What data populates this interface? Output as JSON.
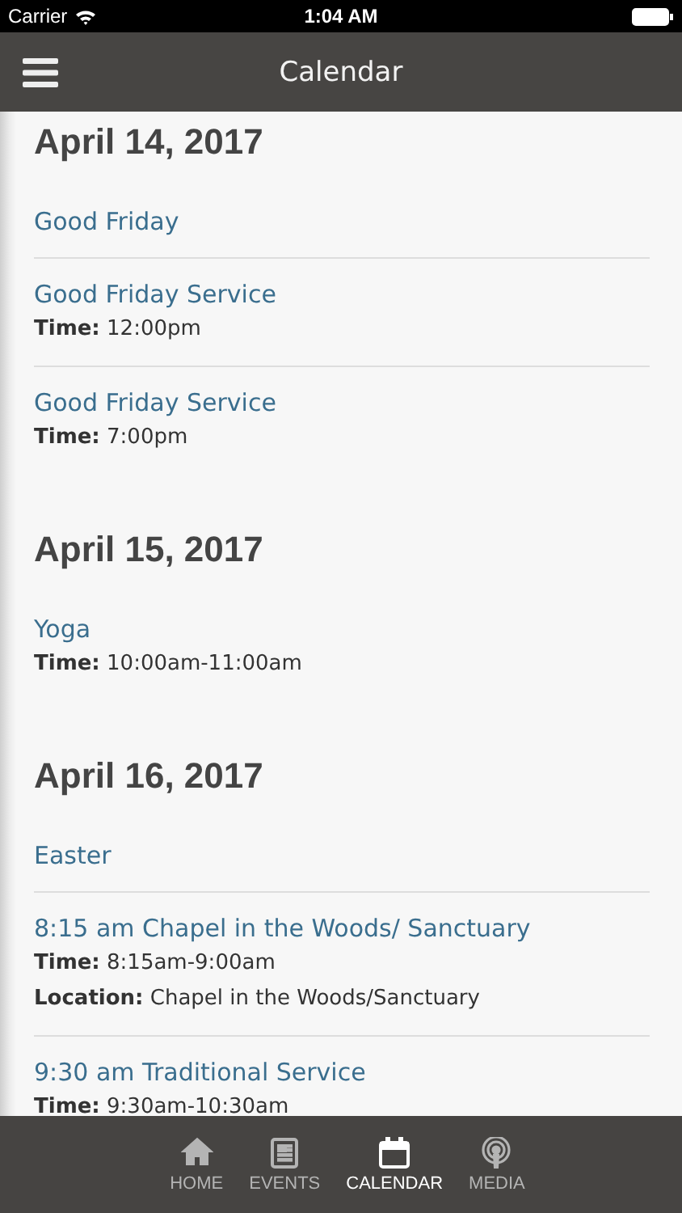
{
  "status_bar": {
    "carrier": "Carrier",
    "time": "1:04 AM"
  },
  "nav_bar": {
    "title": "Calendar"
  },
  "days": [
    {
      "date": "April 14, 2017",
      "events": [
        {
          "title": "Good Friday"
        },
        {
          "title": "Good Friday Service",
          "details": [
            "**Time:** 12:00pm"
          ]
        },
        {
          "title": "Good Friday Service",
          "details": [
            "**Time:** 7:00pm"
          ]
        }
      ]
    },
    {
      "date": "April 15, 2017",
      "events": [
        {
          "title": "Yoga",
          "details": [
            "**Time:** 10:00am-11:00am"
          ]
        }
      ]
    },
    {
      "date": "April 16, 2017",
      "events": [
        {
          "title": "Easter"
        },
        {
          "title": "8:15 am Chapel in the Woods/ Sanctuary",
          "details": [
            "**Time:** 8:15am-9:00am",
            "**Location:** Chapel in the Woods/Sanctuary"
          ]
        },
        {
          "title": "9:30 am Traditional Service",
          "details": [
            "**Time:** 9:30am-10:30am"
          ]
        }
      ]
    }
  ],
  "tabs": [
    {
      "kind": "home",
      "label": "HOME",
      "selected": false
    },
    {
      "kind": "events",
      "label": "EVENTS",
      "selected": false
    },
    {
      "kind": "calendar",
      "label": "CALENDAR",
      "selected": true
    },
    {
      "kind": "media",
      "label": "MEDIA",
      "selected": false
    }
  ]
}
